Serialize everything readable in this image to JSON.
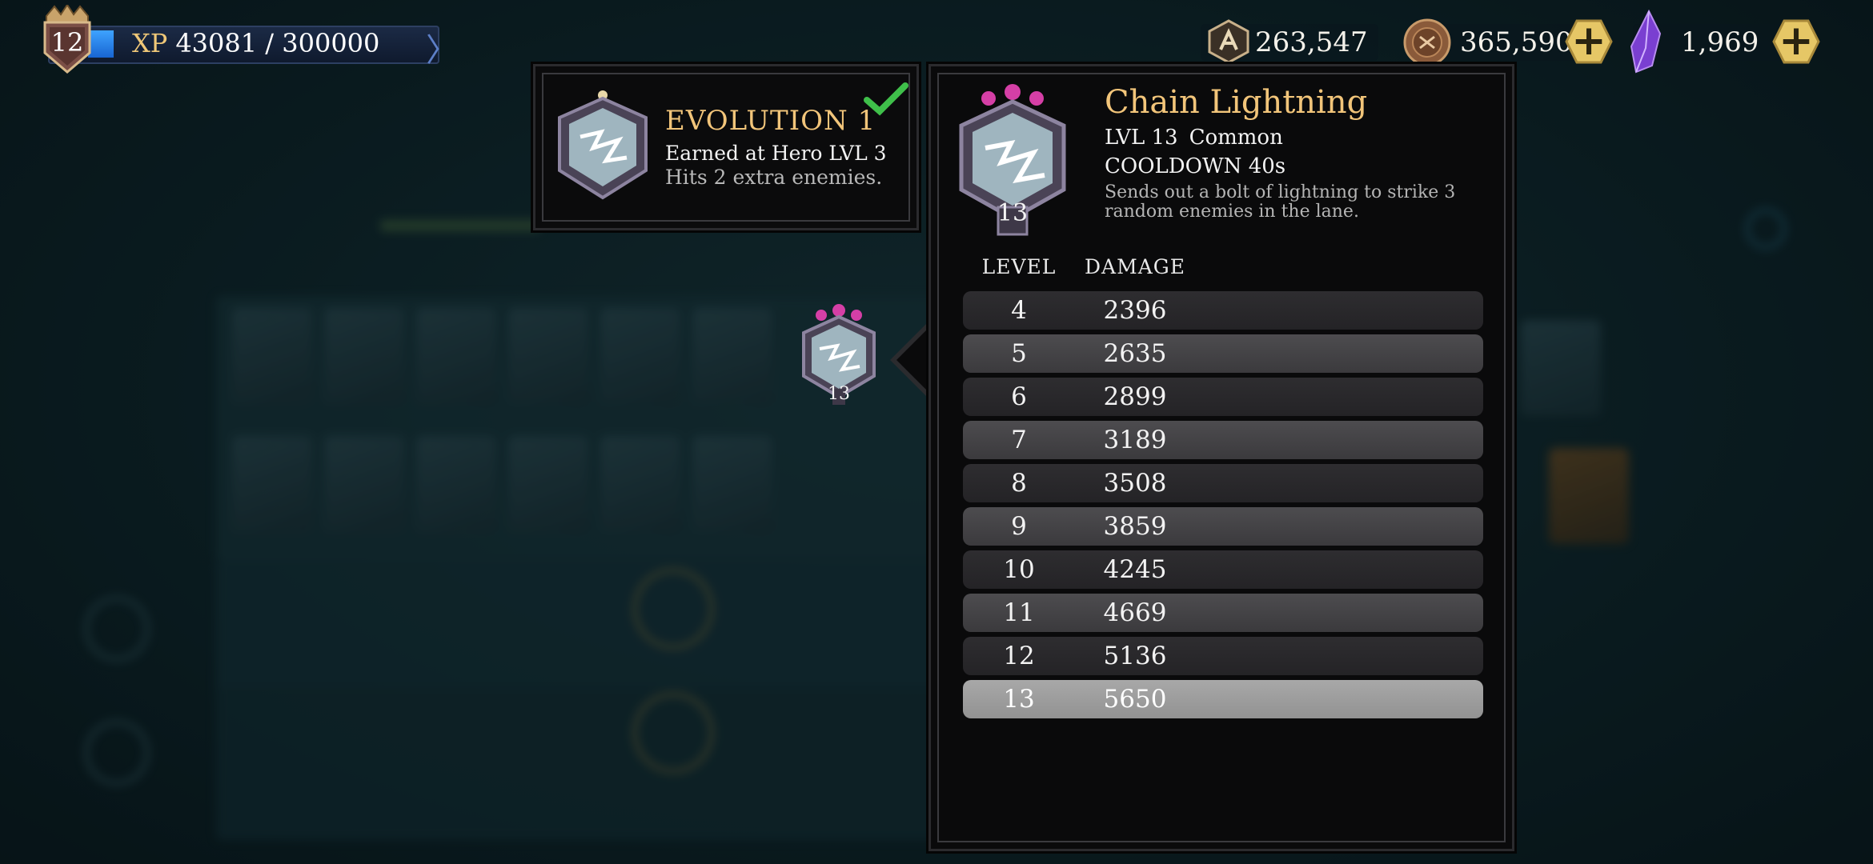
{
  "player": {
    "level": "12",
    "xp_label": "XP",
    "xp_value": "43081 / 300000",
    "xp_progress": 0.1436
  },
  "currencies": [
    {
      "name": "tokens",
      "value": "263,547",
      "icon": "hex-badge-icon",
      "has_plus": false
    },
    {
      "name": "coins",
      "value": "365,590",
      "icon": "bronze-coin-icon",
      "has_plus": true
    },
    {
      "name": "gems",
      "value": "1,969",
      "icon": "purple-crystal-icon",
      "has_plus": true
    }
  ],
  "evolution": {
    "title": "EVOLUTION 1",
    "requirement": "Earned at Hero LVL 3",
    "effect": "Hits 2 extra enemies.",
    "completed": true
  },
  "skill": {
    "name": "Chain Lightning",
    "level_label": "LVL 13",
    "rarity": "Common",
    "cooldown": "COOLDOWN 40s",
    "description": "Sends out a bolt of lightning to strike 3 random enemies in the lane.",
    "icon_level": "13",
    "table_headers": {
      "level": "LEVEL",
      "damage": "DAMAGE"
    },
    "table_rows": [
      {
        "level": "4",
        "damage": "2396"
      },
      {
        "level": "5",
        "damage": "2635"
      },
      {
        "level": "6",
        "damage": "2899"
      },
      {
        "level": "7",
        "damage": "3189"
      },
      {
        "level": "8",
        "damage": "3508"
      },
      {
        "level": "9",
        "damage": "3859"
      },
      {
        "level": "10",
        "damage": "4245"
      },
      {
        "level": "11",
        "damage": "4669"
      },
      {
        "level": "12",
        "damage": "5136"
      },
      {
        "level": "13",
        "damage": "5650"
      }
    ],
    "selected_level": "13"
  },
  "colors": {
    "title_gold": "#f2c57a",
    "check_green": "#3fbf4a",
    "gem_pink": "#d53fa6",
    "xp_blue": "#2f8cf0"
  }
}
